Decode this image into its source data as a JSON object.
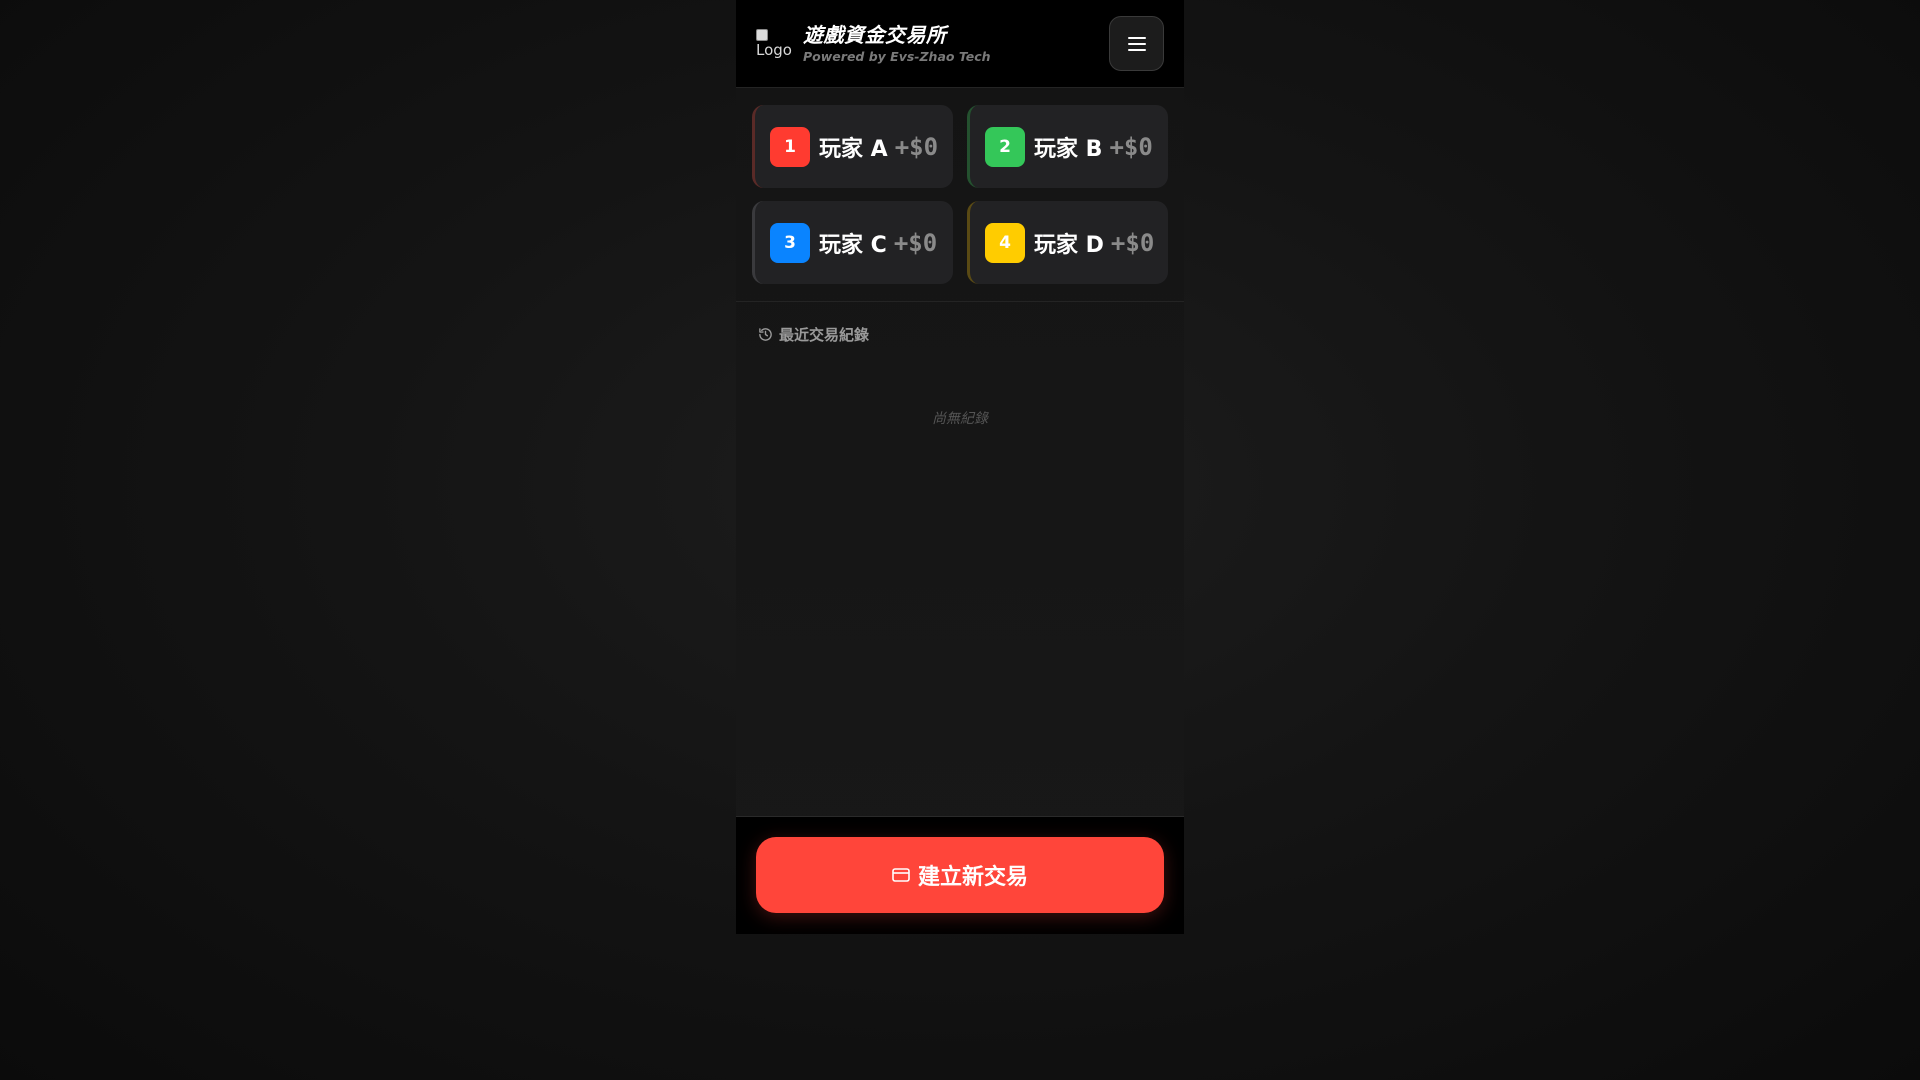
{
  "header": {
    "logo_alt": "Logo",
    "title": "遊戲資金交易所",
    "subtitle": "Powered by Evs-Zhao Tech",
    "menu_icon": "hamburger-menu-icon"
  },
  "players": [
    {
      "number": "1",
      "name": "玩家 A",
      "amount": "+$0",
      "color": "#ff3b30"
    },
    {
      "number": "2",
      "name": "玩家 B",
      "amount": "+$0",
      "color": "#34c759"
    },
    {
      "number": "3",
      "name": "玩家 C",
      "amount": "+$0",
      "color": "#0a84ff"
    },
    {
      "number": "4",
      "name": "玩家 D",
      "amount": "+$0",
      "color": "#ffcc00"
    }
  ],
  "history": {
    "icon": "history-icon",
    "title": "最近交易紀錄",
    "empty_text": "尚無紀錄"
  },
  "footer": {
    "button_icon": "credit-card-icon",
    "button_label": "建立新交易",
    "button_color": "#ff453a"
  }
}
